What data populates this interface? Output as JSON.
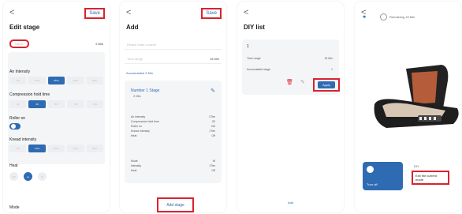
{
  "screen1": {
    "back": "<",
    "save": "Save",
    "title": "Edit stage",
    "name_placeholder": "Name",
    "duration": "2 Min",
    "air_intensity_label": "Air Intensity",
    "air_levels": [
      "Off",
      "1Tier",
      "2Tier",
      "3Tier",
      "4Tier"
    ],
    "compression_label": "Compression hold time",
    "compression_levels": [
      "0s",
      "3S",
      "5S",
      "8S",
      "10S"
    ],
    "roller_label": "Roller on",
    "knead_label": "Knead intensity",
    "knead_levels": [
      "Off",
      "1Tier",
      "2Tier",
      "3Tier",
      "4Tier"
    ],
    "heat_label": "Heat",
    "heat_levels": [
      "Off",
      "Lo",
      "Hi"
    ],
    "mode_label": "Mode"
  },
  "screen2": {
    "back": "<",
    "save": "Save",
    "title": "Add",
    "name_placeholder": "Please enter a name",
    "time_range_label": "Time range",
    "time_range_value": "15 Min",
    "accumulated": "Accumulated 2 Min",
    "stage_title": "Number 1 Stage",
    "stage_time": "2 Min",
    "rows": [
      {
        "k": "Air intensity",
        "v": "2Tier"
      },
      {
        "k": "Compression hold time",
        "v": "3S"
      },
      {
        "k": "Roller on",
        "v": "ON"
      },
      {
        "k": "Knead intensity",
        "v": "1Tier"
      },
      {
        "k": "Heat",
        "v": "Off"
      }
    ],
    "rows2": [
      {
        "k": "Mode",
        "v": "W"
      },
      {
        "k": "Intensity",
        "v": "1Tier"
      },
      {
        "k": "Heat",
        "v": "Off"
      }
    ],
    "add_stage": "Add stage"
  },
  "screen3": {
    "back": "<",
    "title": "DIY list",
    "item_number": "1",
    "range_label": "Time range",
    "range_value": "15 Min",
    "accum_label": "Accumulated stage",
    "accum_value": "1",
    "apply": "Apply",
    "add": "Add"
  },
  "screen4": {
    "back": "<",
    "remaining": "Remaining 15 Min",
    "turn_off": "Turn off",
    "exit_title": "DIY",
    "exit_text": "Exit the current mode"
  },
  "colors": {
    "accent": "#2f6bb3",
    "highlight": "#d9232d"
  }
}
